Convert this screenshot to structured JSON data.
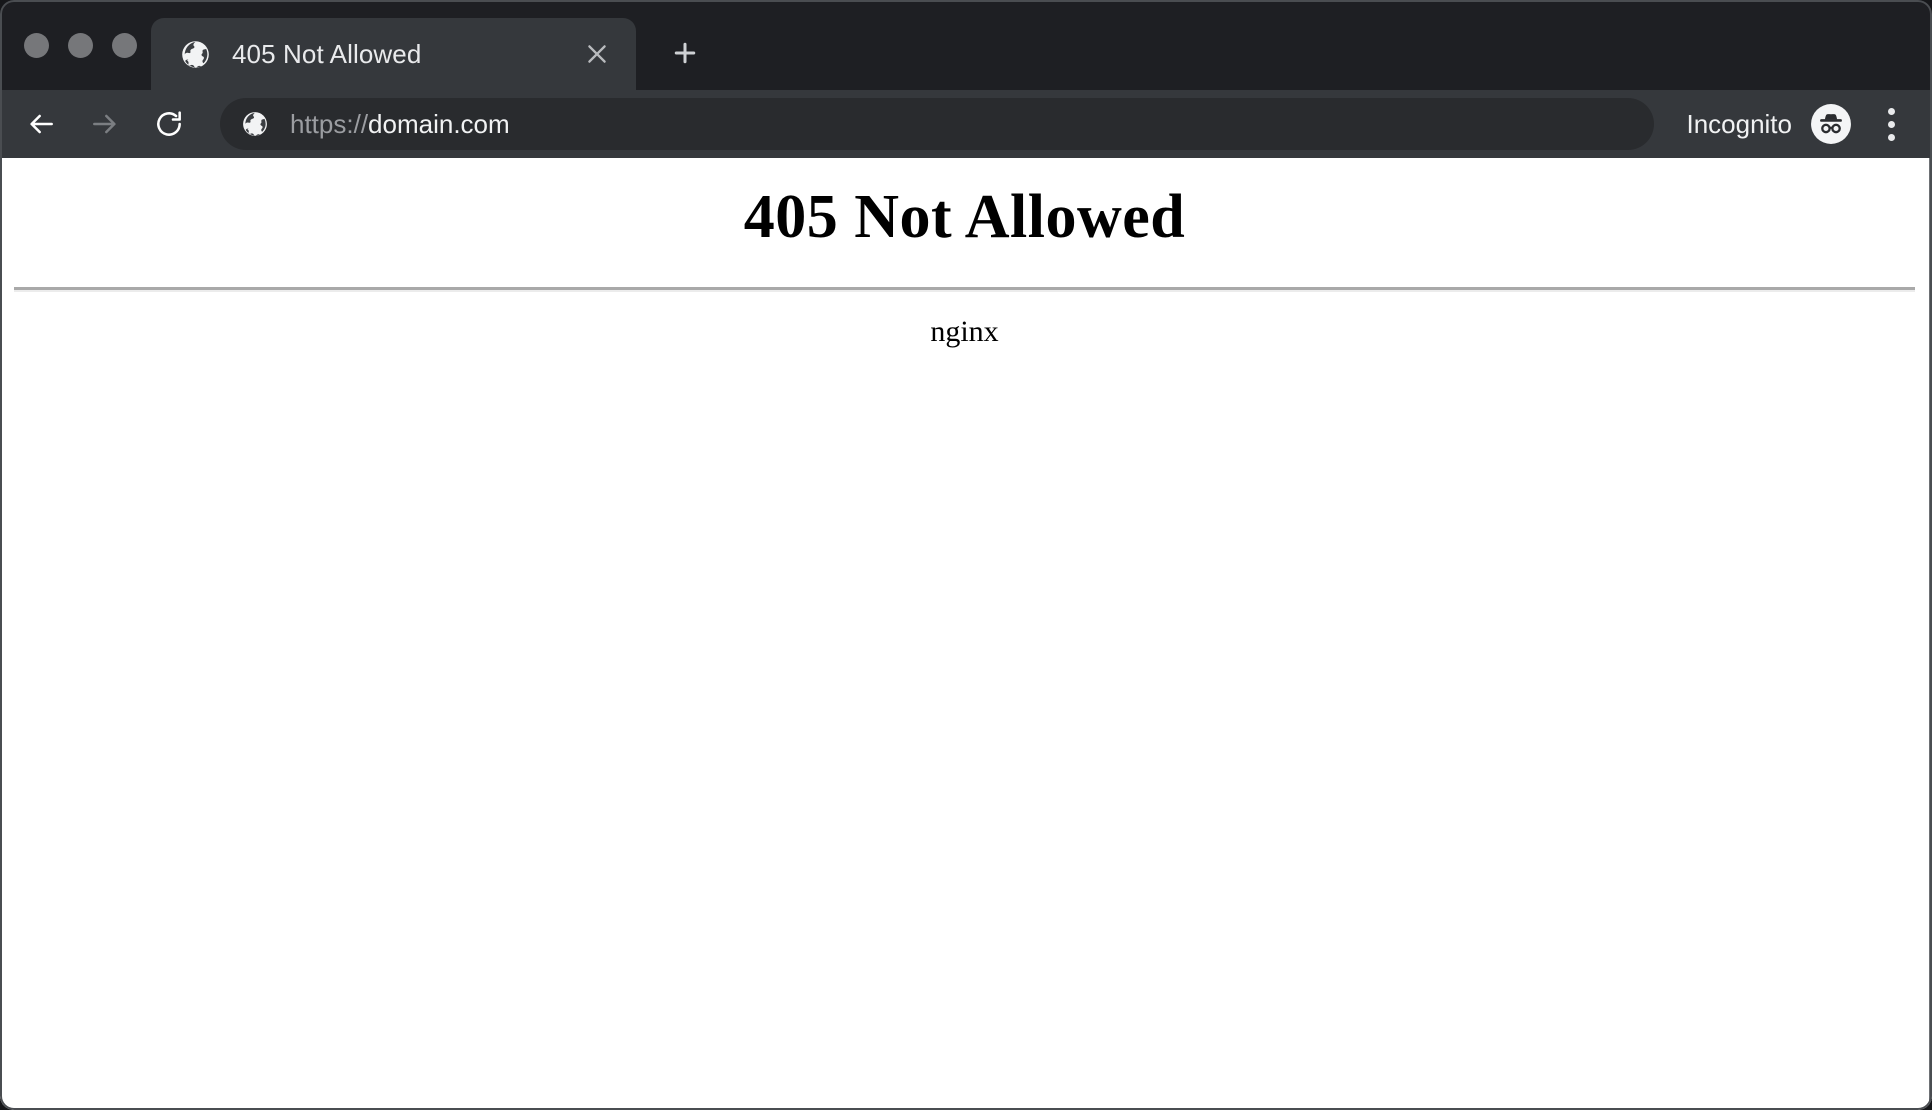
{
  "window": {
    "controls": [
      {
        "name": "close",
        "color": "#76777a"
      },
      {
        "name": "minimize",
        "color": "#76777a"
      },
      {
        "name": "maximize",
        "color": "#76777a"
      }
    ],
    "chrome_bg": "#1e1f23",
    "toolbar_bg": "#35383c",
    "omnibox_bg": "#292b2e"
  },
  "tabs": [
    {
      "title": "405 Not Allowed",
      "favicon": "globe-icon",
      "close_label": "×",
      "active": true
    }
  ],
  "tab_strip": {
    "new_tab_label": "+",
    "new_tab_icon": "plus-icon"
  },
  "toolbar": {
    "back_icon": "arrow-left-icon",
    "back_enabled": true,
    "forward_icon": "arrow-right-icon",
    "forward_enabled": false,
    "reload_icon": "reload-icon",
    "omnibox": {
      "site_icon": "globe-icon",
      "scheme": "https://",
      "host": "domain.com",
      "value": "https://domain.com",
      "placeholder": "Search or type URL"
    },
    "incognito": {
      "label": "Incognito",
      "icon": "incognito-icon"
    },
    "menu_icon": "more-vertical-icon"
  },
  "page": {
    "heading": "405 Not Allowed",
    "server": "nginx",
    "background": "#ffffff",
    "text_color": "#000000",
    "rule_color": "#a9a9a9"
  }
}
